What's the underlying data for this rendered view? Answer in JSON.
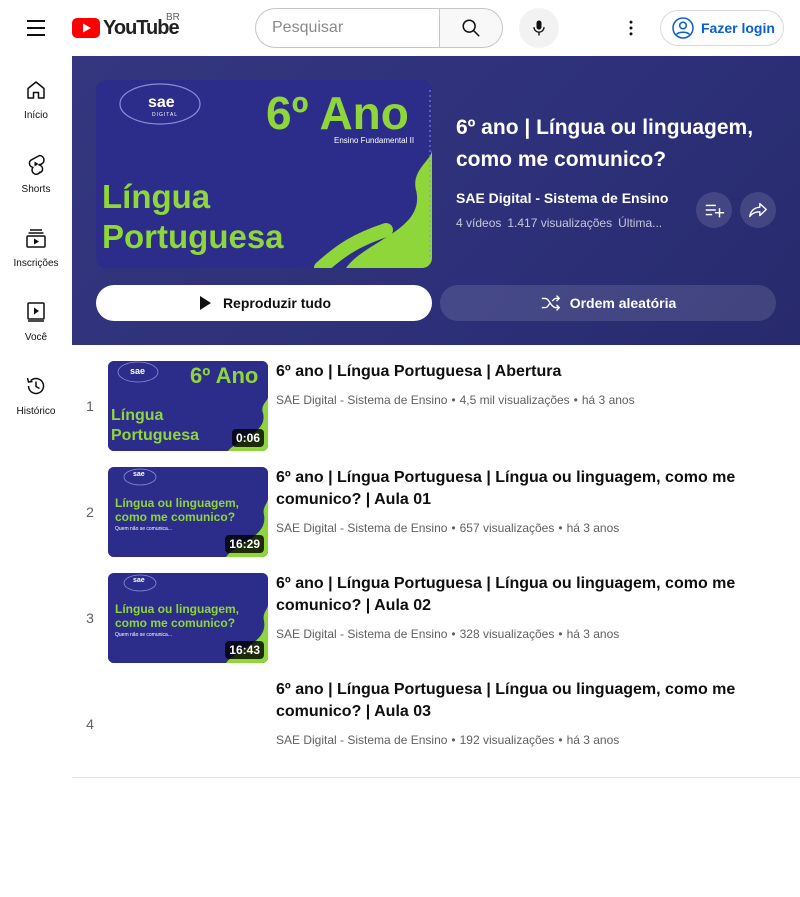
{
  "topbar": {
    "logo_text": "YouTube",
    "region": "BR",
    "search_placeholder": "Pesquisar",
    "login_label": "Fazer login"
  },
  "sidenav": {
    "items": [
      {
        "label": "Início",
        "icon": "home-icon"
      },
      {
        "label": "Shorts",
        "icon": "shorts-icon"
      },
      {
        "label": "Inscrições",
        "icon": "subscriptions-icon"
      },
      {
        "label": "Você",
        "icon": "you-icon"
      },
      {
        "label": "Histórico",
        "icon": "history-icon"
      }
    ]
  },
  "playlist": {
    "title": "6º ano | Língua ou linguagem, como me comunico?",
    "channel": "SAE Digital - Sistema de Ensino",
    "video_count": "4 vídeos",
    "views": "1.417 visualizações",
    "updated": "Última...",
    "play_all_label": "Reproduzir tudo",
    "shuffle_label": "Ordem aleatória",
    "thumb": {
      "brand": "sae",
      "brand_sub": "DIGITAL",
      "grade": "6º Ano",
      "grade_sub": "Ensino Fundamental II",
      "subject_line1": "Língua",
      "subject_line2": "Portuguesa"
    }
  },
  "videos": [
    {
      "index": "1",
      "title": "6º ano | Língua Portuguesa | Abertura",
      "channel": "SAE Digital - Sistema de Ensino",
      "views": "4,5 mil visualizações",
      "age": "há 3 anos",
      "duration": "0:06",
      "thumb_line1": "Língua",
      "thumb_line2": "Portuguesa",
      "thumb_grade": "6º Ano",
      "thumb_brand": "sae"
    },
    {
      "index": "2",
      "title": "6º ano | Língua Portuguesa | Língua ou linguagem, como me comunico? | Aula 01",
      "channel": "SAE Digital - Sistema de Ensino",
      "views": "657 visualizações",
      "age": "há 3 anos",
      "duration": "16:29",
      "thumb_line1": "Língua ou linguagem,",
      "thumb_line2": "como me comunico?",
      "thumb_small": "Quem não se comunica...",
      "thumb_brand": "sae"
    },
    {
      "index": "3",
      "title": "6º ano | Língua Portuguesa | Língua ou linguagem, como me comunico? | Aula 02",
      "channel": "SAE Digital - Sistema de Ensino",
      "views": "328 visualizações",
      "age": "há 3 anos",
      "duration": "16:43",
      "thumb_line1": "Língua ou linguagem,",
      "thumb_line2": "como me comunico?",
      "thumb_small": "Quem não se comunica...",
      "thumb_brand": "sae"
    },
    {
      "index": "4",
      "title": "6º ano | Língua Portuguesa | Língua ou linguagem, como me comunico? | Aula 03",
      "channel": "SAE Digital - Sistema de Ensino",
      "views": "192 visualizações",
      "age": "há 3 anos"
    }
  ],
  "colors": {
    "header_bg": "#2e317a",
    "thumb_bg": "#2c2d8a",
    "thumb_green": "#8fd63a",
    "login_blue": "#065fd4",
    "youtube_red": "#ff0000"
  }
}
